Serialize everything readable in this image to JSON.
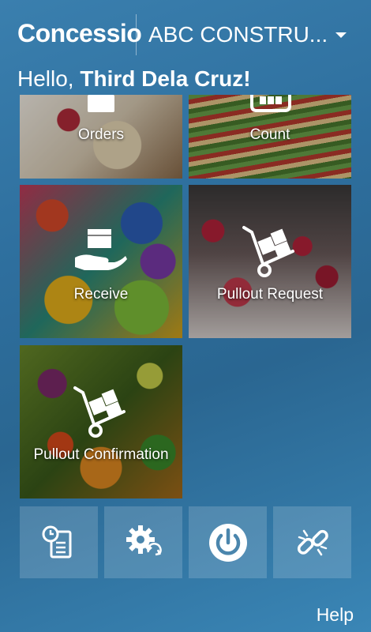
{
  "header": {
    "brand": "Concessio",
    "organization": "ABC CONSTRU...",
    "greeting_prefix": "Hello, ",
    "user_name": "Third Dela Cruz!"
  },
  "tiles": [
    {
      "label": "Orders",
      "icon": "box-icon"
    },
    {
      "label": "Count",
      "icon": "grid-count-icon"
    },
    {
      "label": "Receive",
      "icon": "hand-box-icon"
    },
    {
      "label": "Pullout Request",
      "icon": "handtruck-icon"
    },
    {
      "label": "Pullout Confirmation",
      "icon": "handtruck-icon"
    }
  ],
  "actions": [
    {
      "icon": "clock-document-icon"
    },
    {
      "icon": "gear-sync-icon"
    },
    {
      "icon": "power-icon"
    },
    {
      "icon": "broken-link-icon"
    }
  ],
  "footer": {
    "help_label": "Help"
  }
}
